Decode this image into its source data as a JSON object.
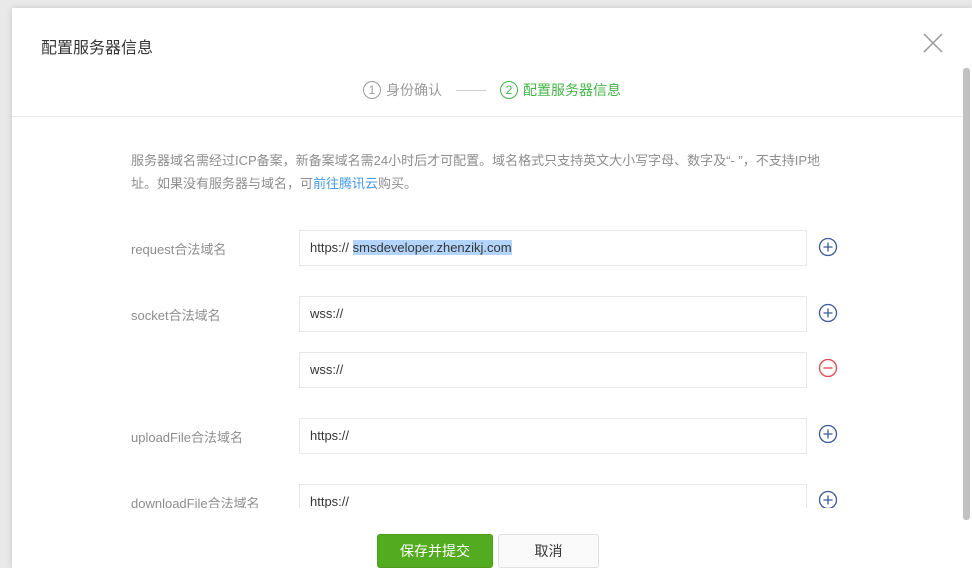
{
  "dialog": {
    "title": "配置服务器信息"
  },
  "steps": [
    {
      "num": "1",
      "label": "身份确认"
    },
    {
      "num": "2",
      "label": "配置服务器信息"
    }
  ],
  "tip": {
    "text1": "服务器域名需经过ICP备案，新备案域名需24小时后才可配置。域名格式只支持英文大小写字母、数字及“- ”，不支持IP地址。如果没有服务器与域名，可",
    "link": "前往腾讯云",
    "text2": "购买。"
  },
  "fields": {
    "request": {
      "label": "request合法域名",
      "prefix": "https:// ",
      "value": "smsdeveloper.zhenzikj.com"
    },
    "socket": {
      "label": "socket合法域名",
      "value1": "wss://",
      "value2": "wss://"
    },
    "upload": {
      "label": "uploadFile合法域名",
      "value": "https://"
    },
    "download": {
      "label": "downloadFile合法域名",
      "value": "https://"
    }
  },
  "buttons": {
    "save": "保存并提交",
    "cancel": "取消"
  },
  "colors": {
    "accent": "#44b549",
    "add": "#3c5a99",
    "remove": "#e0454b"
  }
}
